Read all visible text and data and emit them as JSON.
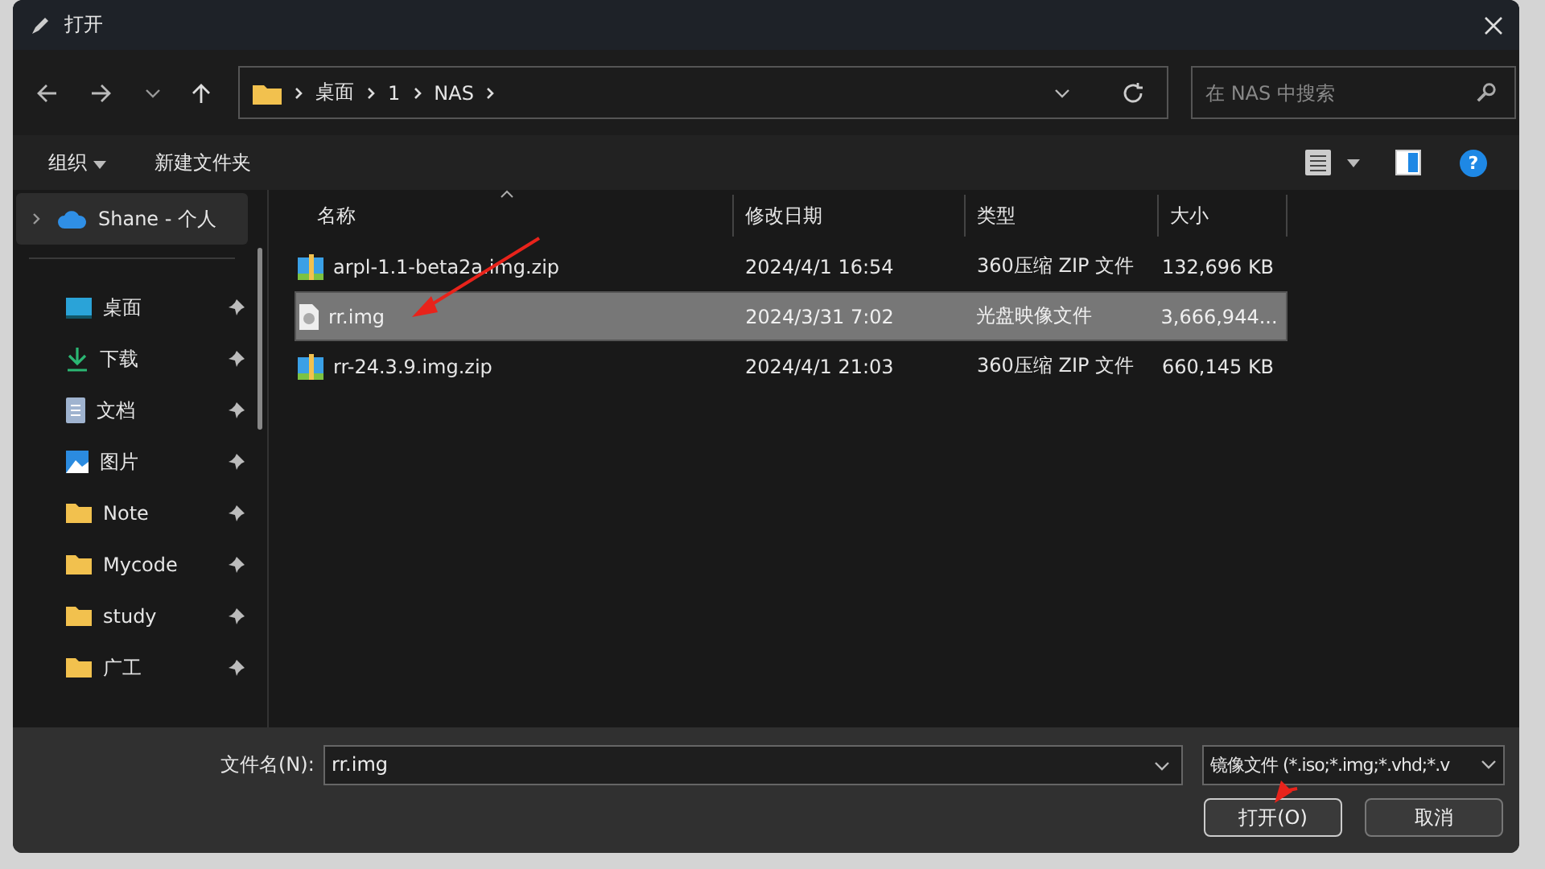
{
  "window": {
    "title": "打开"
  },
  "address": {
    "crumbs": [
      "桌面",
      "1",
      "NAS"
    ]
  },
  "search": {
    "placeholder": "在 NAS 中搜索"
  },
  "toolbar": {
    "organize": "组织",
    "new_folder": "新建文件夹",
    "help": "?"
  },
  "sidebar": {
    "items": [
      {
        "label": "Shane - 个人",
        "kind": "cloud",
        "selected": true,
        "pinned": false
      },
      {
        "label": "桌面",
        "kind": "desktop",
        "selected": false,
        "pinned": true
      },
      {
        "label": "下载",
        "kind": "download",
        "selected": false,
        "pinned": true
      },
      {
        "label": "文档",
        "kind": "document",
        "selected": false,
        "pinned": true
      },
      {
        "label": "图片",
        "kind": "picture",
        "selected": false,
        "pinned": true
      },
      {
        "label": "Note",
        "kind": "folder",
        "selected": false,
        "pinned": true
      },
      {
        "label": "Mycode",
        "kind": "folder",
        "selected": false,
        "pinned": true
      },
      {
        "label": "study",
        "kind": "folder",
        "selected": false,
        "pinned": true
      },
      {
        "label": "广工",
        "kind": "folder",
        "selected": false,
        "pinned": true
      }
    ]
  },
  "table": {
    "columns": [
      "名称",
      "修改日期",
      "类型",
      "大小"
    ],
    "rows": [
      {
        "name": "arpl-1.1-beta2a.img.zip",
        "date": "2024/4/1 16:54",
        "type": "360压缩 ZIP 文件",
        "size": "132,696 KB",
        "kind": "zip",
        "selected": false
      },
      {
        "name": "rr.img",
        "date": "2024/3/31 7:02",
        "type": "光盘映像文件",
        "size": "3,666,944...",
        "kind": "disc",
        "selected": true
      },
      {
        "name": "rr-24.3.9.img.zip",
        "date": "2024/4/1 21:03",
        "type": "360压缩 ZIP 文件",
        "size": "660,145 KB",
        "kind": "zip",
        "selected": false
      }
    ]
  },
  "footer": {
    "filename_label": "文件名(N):",
    "filename": "rr.img",
    "filetype": "镜像文件 (*.iso;*.img;*.vhd;*.v",
    "open": "打开(O)",
    "cancel": "取消"
  }
}
